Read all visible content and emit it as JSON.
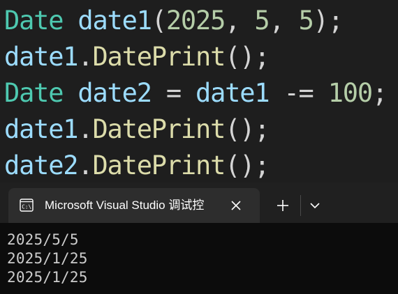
{
  "editor": {
    "lines": [
      [
        {
          "text": "Date",
          "cls": "tok-type"
        },
        {
          "text": " ",
          "cls": "tok-punc"
        },
        {
          "text": "date1",
          "cls": "tok-var"
        },
        {
          "text": "(",
          "cls": "tok-punc"
        },
        {
          "text": "2025",
          "cls": "tok-num"
        },
        {
          "text": ", ",
          "cls": "tok-punc"
        },
        {
          "text": "5",
          "cls": "tok-num"
        },
        {
          "text": ", ",
          "cls": "tok-punc"
        },
        {
          "text": "5",
          "cls": "tok-num"
        },
        {
          "text": ");",
          "cls": "tok-punc"
        }
      ],
      [
        {
          "text": "date1",
          "cls": "tok-var"
        },
        {
          "text": ".",
          "cls": "tok-punc"
        },
        {
          "text": "DatePrint",
          "cls": "tok-fn"
        },
        {
          "text": "();",
          "cls": "tok-punc"
        }
      ],
      [
        {
          "text": "Date",
          "cls": "tok-type"
        },
        {
          "text": " ",
          "cls": "tok-punc"
        },
        {
          "text": "date2",
          "cls": "tok-var"
        },
        {
          "text": " = ",
          "cls": "tok-punc"
        },
        {
          "text": "date1",
          "cls": "tok-var"
        },
        {
          "text": " -= ",
          "cls": "tok-punc"
        },
        {
          "text": "100",
          "cls": "tok-num"
        },
        {
          "text": ";",
          "cls": "tok-punc"
        }
      ],
      [
        {
          "text": "date1",
          "cls": "tok-var"
        },
        {
          "text": ".",
          "cls": "tok-punc"
        },
        {
          "text": "DatePrint",
          "cls": "tok-fn"
        },
        {
          "text": "();",
          "cls": "tok-punc"
        }
      ],
      [
        {
          "text": "date2",
          "cls": "tok-var"
        },
        {
          "text": ".",
          "cls": "tok-punc"
        },
        {
          "text": "DatePrint",
          "cls": "tok-fn"
        },
        {
          "text": "();",
          "cls": "tok-punc"
        }
      ]
    ]
  },
  "terminal": {
    "tab": {
      "icon": "console-icon",
      "title": "Microsoft Visual Studio 调试控"
    },
    "buttons": {
      "close_icon": "close-icon",
      "new_tab_icon": "plus-icon",
      "dropdown_icon": "chevron-down-icon"
    },
    "output": [
      "2025/5/5",
      "2025/1/25",
      "2025/1/25"
    ]
  },
  "colors": {
    "editor_bg": "#1e1e1e",
    "type": "#4ec9b0",
    "variable": "#9cdcfe",
    "function": "#dcdcaa",
    "number": "#b5cea8",
    "punctuation": "#d4d4d4",
    "terminal_bg": "#0c0c0c",
    "tabbar_bg": "#202020",
    "tab_bg": "#2d2d2d"
  }
}
